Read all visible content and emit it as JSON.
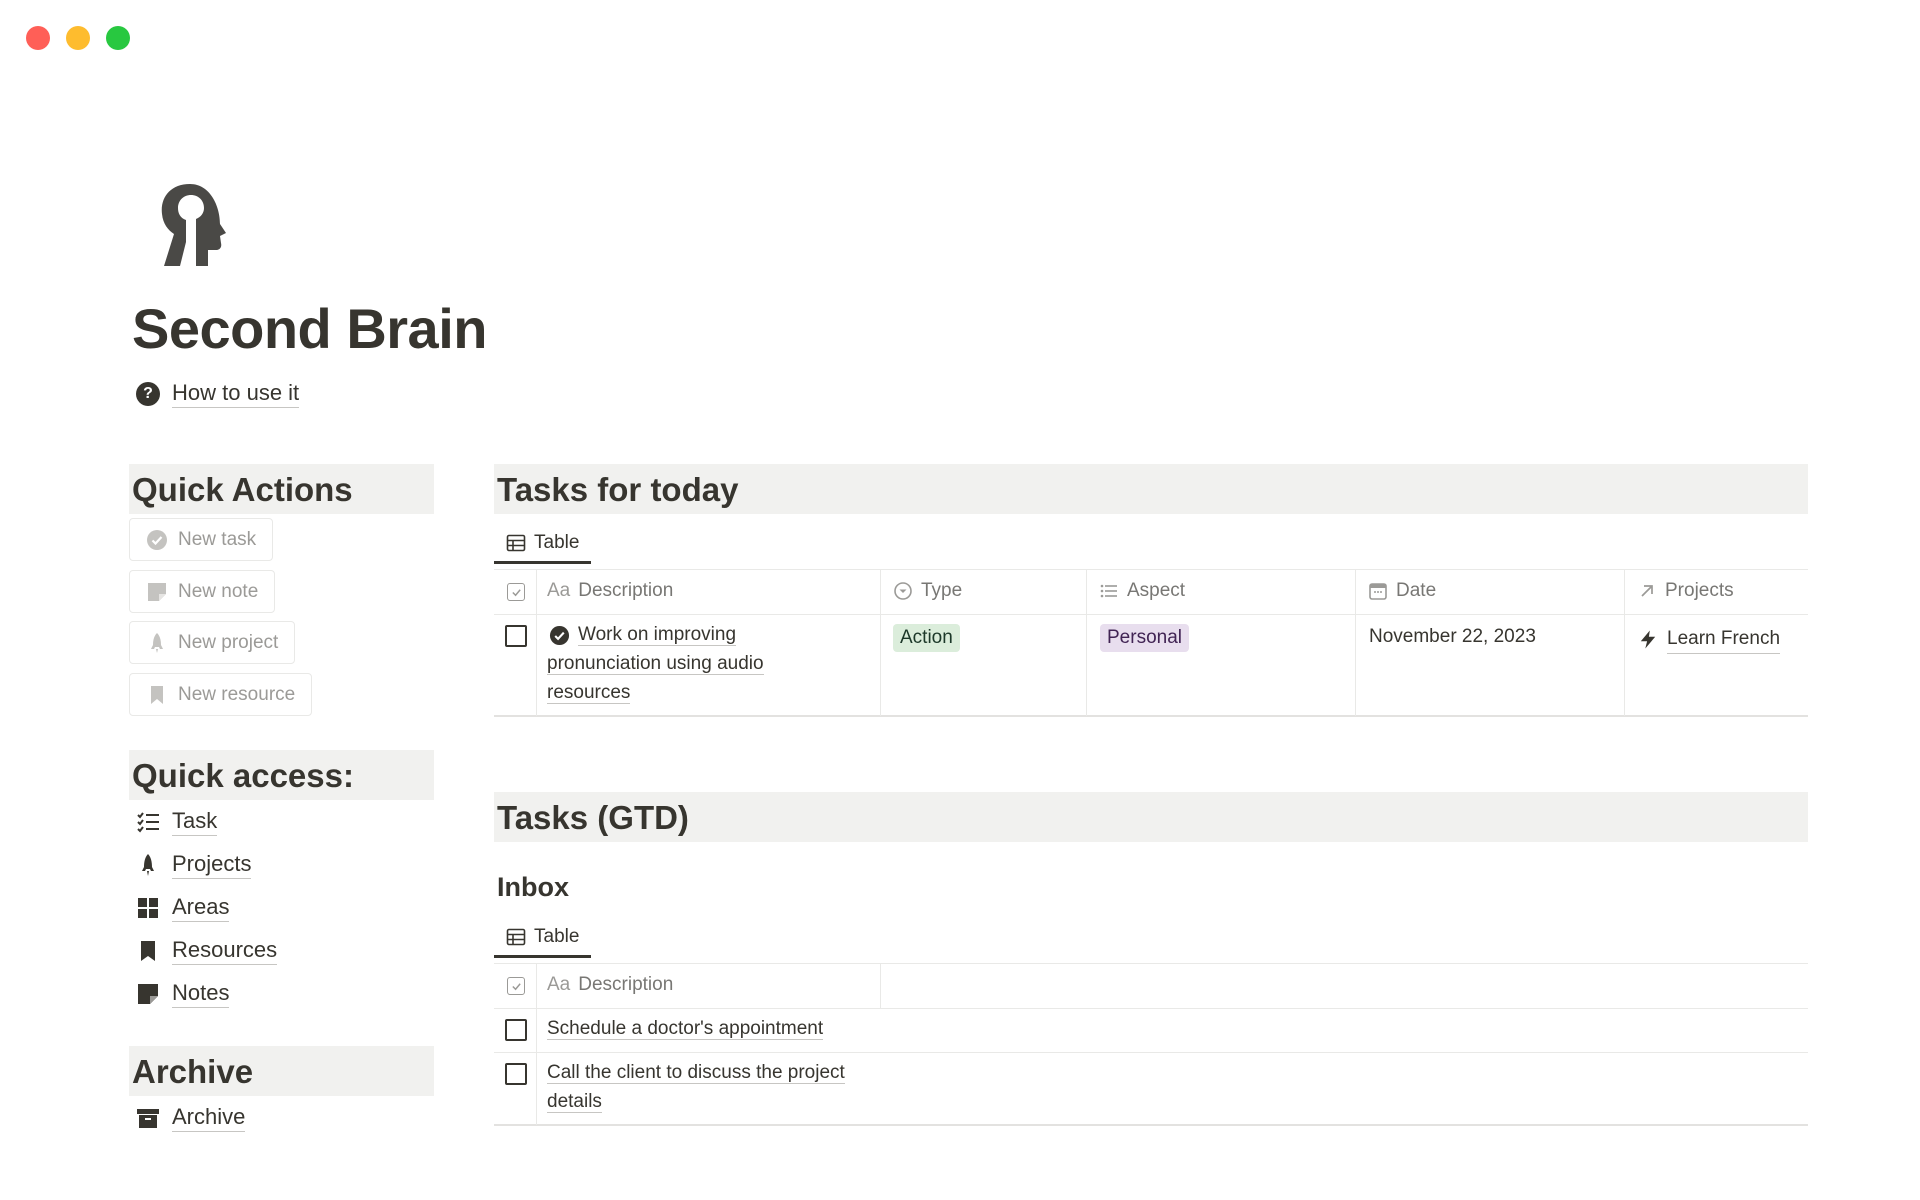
{
  "page": {
    "title": "Second Brain",
    "icon": "brain-head-icon",
    "help_link": "How to use it"
  },
  "quick_actions": {
    "heading": "Quick Actions",
    "buttons": [
      {
        "label": "New task",
        "icon": "check-circle-icon"
      },
      {
        "label": "New note",
        "icon": "note-icon"
      },
      {
        "label": "New project",
        "icon": "rocket-icon"
      },
      {
        "label": "New resource",
        "icon": "bookmark-icon"
      }
    ]
  },
  "quick_access": {
    "heading": "Quick access:",
    "links": [
      {
        "label": "Task",
        "icon": "checklist-icon"
      },
      {
        "label": "Projects",
        "icon": "rocket-icon"
      },
      {
        "label": "Areas",
        "icon": "grid-icon"
      },
      {
        "label": "Resources",
        "icon": "bookmark-icon"
      },
      {
        "label": "Notes",
        "icon": "note-icon"
      }
    ]
  },
  "archive": {
    "heading": "Archive",
    "links": [
      {
        "label": "Archive",
        "icon": "archive-box-icon"
      }
    ]
  },
  "tasks_today": {
    "heading": "Tasks for today",
    "view_tab": "Table",
    "columns": [
      {
        "label": "Description",
        "prefix": "Aa"
      },
      {
        "label": "Type",
        "icon": "select-icon"
      },
      {
        "label": "Aspect",
        "icon": "list-icon"
      },
      {
        "label": "Date",
        "icon": "calendar-icon"
      },
      {
        "label": "Projects",
        "icon": "arrow-up-right-icon"
      }
    ],
    "rows": [
      {
        "description_line1": "Work on improving",
        "description_line2": "pronunciation using audio",
        "description_line3": "resources",
        "type": "Action",
        "aspect": "Personal",
        "date": "November 22, 2023",
        "project": "Learn French"
      }
    ]
  },
  "tasks_gtd": {
    "heading": "Tasks (GTD)",
    "subheading": "Inbox",
    "view_tab": "Table",
    "column": {
      "label": "Description",
      "prefix": "Aa"
    },
    "rows": [
      {
        "line1": "Schedule a doctor's appointment",
        "line2": ""
      },
      {
        "line1": "Call the client to discuss the project",
        "line2": "details"
      }
    ]
  },
  "colors": {
    "text": "#37352f",
    "muted": "#787774",
    "section_bg": "#f1f1ef",
    "tag_action_bg": "#dbeddb",
    "tag_personal_bg": "#e8deee"
  }
}
